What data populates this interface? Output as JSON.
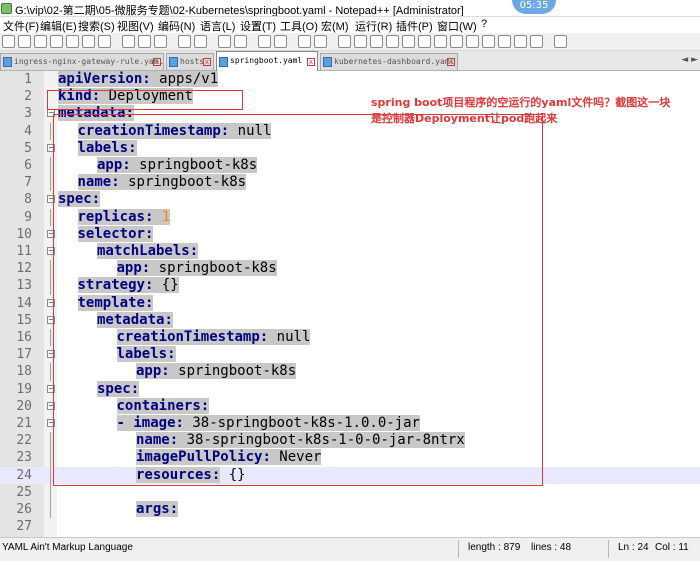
{
  "window": {
    "title": "G:\\vip\\02-第二期\\05-微服务专题\\02-Kubernetes\\springboot.yaml - Notepad++ [Administrator]",
    "clock": "05:35"
  },
  "menu": [
    "文件(F)",
    "编辑(E)",
    "搜索(S)",
    "视图(V)",
    "编码(N)",
    "语言(L)",
    "设置(T)",
    "工具(O)",
    "宏(M)",
    "运行(R)",
    "插件(P)",
    "窗口(W)",
    "?"
  ],
  "tabs": [
    {
      "label": "ingress-nginx-gateway-rule.yaml",
      "active": false
    },
    {
      "label": "hosts",
      "active": false
    },
    {
      "label": "springboot.yaml",
      "active": true
    },
    {
      "label": "kubernetes-dashboard.yaml",
      "active": false
    }
  ],
  "editor": {
    "lines": [
      {
        "n": "1",
        "indent": 0,
        "key": "apiVersion",
        "value": " apps/v1"
      },
      {
        "n": "2",
        "indent": 0,
        "key": "kind",
        "value": " Deployment"
      },
      {
        "n": "3",
        "indent": 0,
        "key": "metadata",
        "value": ""
      },
      {
        "n": "4",
        "indent": 1,
        "key": "creationTimestamp",
        "value": " null"
      },
      {
        "n": "5",
        "indent": 1,
        "key": "labels",
        "value": ""
      },
      {
        "n": "6",
        "indent": 2,
        "key": "app",
        "value": " springboot-k8s"
      },
      {
        "n": "7",
        "indent": 1,
        "key": "name",
        "value": " springboot-k8s"
      },
      {
        "n": "8",
        "indent": 0,
        "key": "spec",
        "value": ""
      },
      {
        "n": "9",
        "indent": 1,
        "key": "replicas",
        "value": " 1"
      },
      {
        "n": "10",
        "indent": 1,
        "key": "selector",
        "value": ""
      },
      {
        "n": "11",
        "indent": 2,
        "key": "matchLabels",
        "value": ""
      },
      {
        "n": "12",
        "indent": 3,
        "key": "app",
        "value": " springboot-k8s"
      },
      {
        "n": "13",
        "indent": 1,
        "key": "strategy",
        "value": " {}"
      },
      {
        "n": "14",
        "indent": 1,
        "key": "template",
        "value": ""
      },
      {
        "n": "15",
        "indent": 2,
        "key": "metadata",
        "value": ""
      },
      {
        "n": "16",
        "indent": 3,
        "key": "creationTimestamp",
        "value": " null"
      },
      {
        "n": "17",
        "indent": 3,
        "key": "labels",
        "value": ""
      },
      {
        "n": "18",
        "indent": 4,
        "key": "app",
        "value": " springboot-k8s"
      },
      {
        "n": "19",
        "indent": 2,
        "key": "spec",
        "value": ""
      },
      {
        "n": "20",
        "indent": 3,
        "key": "containers",
        "value": ""
      },
      {
        "n": "21",
        "indent": 3,
        "key": "- image",
        "value": " 38-springboot-k8s-1.0.0-jar"
      },
      {
        "n": "22",
        "indent": 4,
        "key": "name",
        "value": " 38-springboot-k8s-1-0-0-jar-8ntrx"
      },
      {
        "n": "23",
        "indent": 4,
        "key": "imagePullPolicy",
        "value": " Never"
      },
      {
        "n": "24",
        "indent": 4,
        "key": "resources",
        "value": " {}"
      },
      {
        "n": "25",
        "indent": 0,
        "key": "",
        "value": ""
      },
      {
        "n": "26",
        "indent": 4,
        "key": "args",
        "value": ""
      },
      {
        "n": "27",
        "indent": 0,
        "key": "",
        "value": ""
      }
    ]
  },
  "annotation": {
    "line1": "spring boot项目程序的空运行的yaml文件吗？截图这一块",
    "line2": "是控制器Deployment让pod跑起来"
  },
  "status": {
    "language": "YAML Ain't Markup Language",
    "length": "length : 879",
    "lines": "lines : 48",
    "ln": "Ln : 24",
    "col": "Col : 11"
  }
}
